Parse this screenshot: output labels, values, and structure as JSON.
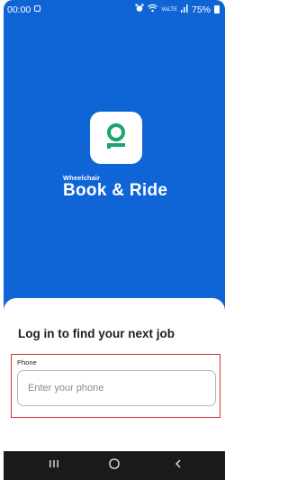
{
  "status_bar": {
    "time": "00:00",
    "volte": "VoLTE",
    "battery": "75%"
  },
  "brand": {
    "subtitle": "Wheelchair",
    "title": "Book & Ride"
  },
  "login": {
    "title": "Log in to find your next job",
    "phone_label": "Phone",
    "phone_placeholder": "Enter your phone",
    "phone_value": ""
  },
  "colors": {
    "brand_blue": "#1065d6",
    "logo_green": "#1aa56a",
    "highlight_red": "#d32f3a"
  },
  "icons": {
    "app": "wheelchair-app-icon",
    "nav_recent": "recent-apps-icon",
    "nav_home": "home-icon",
    "nav_back": "back-icon"
  }
}
